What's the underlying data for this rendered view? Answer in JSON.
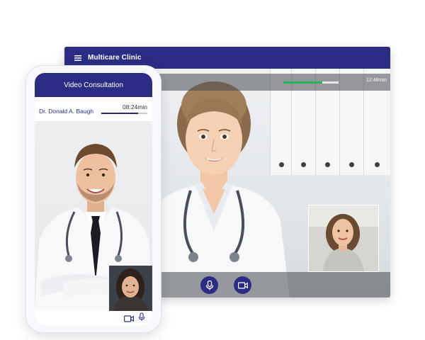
{
  "desktop": {
    "app_title": "Multicare Clinic",
    "call_time": "12:48min",
    "call_progress": 0.7,
    "accent_color": "#2b2d84",
    "progress_color": "#25b45c",
    "controls": [
      {
        "icon": "microphone-icon"
      },
      {
        "icon": "video-camera-icon"
      }
    ]
  },
  "phone": {
    "header_title": "Video Consultation",
    "doctor_name": "Dr. Donald A. Baugh",
    "call_time": "08:24min",
    "call_progress": 0.8,
    "controls": [
      {
        "icon": "video-camera-icon"
      },
      {
        "icon": "microphone-icon"
      }
    ]
  }
}
